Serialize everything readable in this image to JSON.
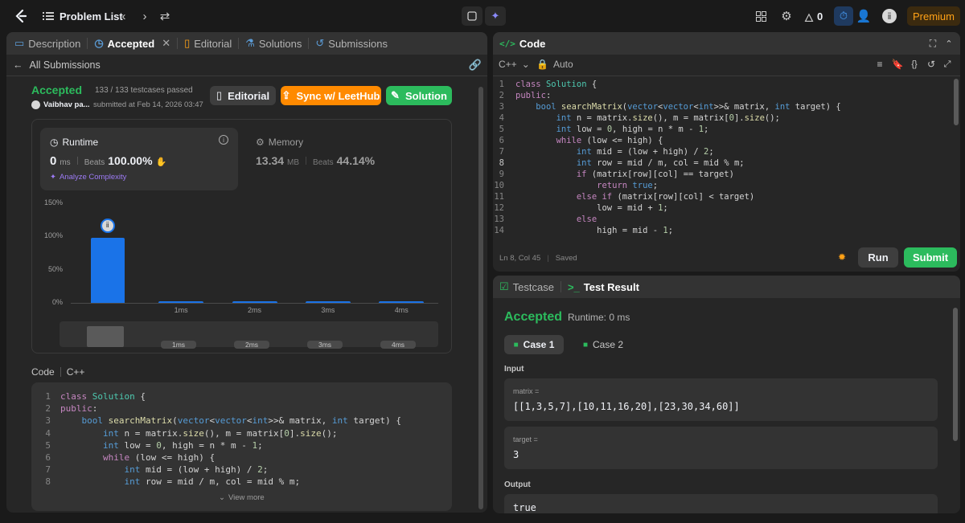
{
  "topbar": {
    "problem_list": "Problem List",
    "streak_count": "0",
    "premium": "Premium"
  },
  "left": {
    "tabs": [
      "Description",
      "Accepted",
      "Editorial",
      "Solutions",
      "Submissions"
    ],
    "back_label": "All Submissions",
    "status": "Accepted",
    "testcases": "133 / 133 testcases passed",
    "user": "Vaibhav pa...",
    "submitted": "submitted at Feb 14, 2026 03:47",
    "btn_editorial": "Editorial",
    "btn_sync": "Sync w/ LeetHub",
    "btn_solution": "Solution",
    "runtime_label": "Runtime",
    "runtime_value": "0",
    "runtime_unit": "ms",
    "beats_label": "Beats",
    "runtime_beats": "100.00%",
    "analyze": "Analyze Complexity",
    "memory_label": "Memory",
    "memory_value": "13.34",
    "memory_unit": "MB",
    "memory_beats": "44.14%",
    "code_label": "Code",
    "code_lang": "C++",
    "view_more": "View more"
  },
  "chart_data": {
    "type": "bar",
    "categories": [
      "",
      "1ms",
      "2ms",
      "3ms",
      "4ms"
    ],
    "values": [
      98,
      3,
      3,
      3,
      3
    ],
    "yticks": [
      "150%",
      "100%",
      "50%",
      "0%"
    ],
    "ylim": [
      0,
      150
    ],
    "mini_labels": [
      "1ms",
      "2ms",
      "3ms",
      "4ms"
    ]
  },
  "code_panel": {
    "title": "Code",
    "lang": "C++",
    "mode": "Auto",
    "status": "Ln 8, Col 45",
    "saved": "Saved",
    "run": "Run",
    "submit": "Submit"
  },
  "result_panel": {
    "tab_testcase": "Testcase",
    "tab_result": "Test Result",
    "status": "Accepted",
    "runtime": "Runtime: 0 ms",
    "case1": "Case 1",
    "case2": "Case 2",
    "input_label": "Input",
    "matrix_label": "matrix =",
    "matrix_value": "[[1,3,5,7],[10,11,16,20],[23,30,34,60]]",
    "target_label": "target =",
    "target_value": "3",
    "output_label": "Output",
    "output_value": "true"
  },
  "code_lines": [
    "class Solution {",
    "public:",
    "    bool searchMatrix(vector<vector<int>>& matrix, int target) {",
    "        int n = matrix.size(), m = matrix[0].size();",
    "        int low = 0, high = n * m - 1;",
    "        while (low <= high) {",
    "            int mid = (low + high) / 2;",
    "            int row = mid / m, col = mid % m;",
    "            if (matrix[row][col] == target)",
    "                return true;",
    "            else if (matrix[row][col] < target)",
    "                low = mid + 1;",
    "            else",
    "                high = mid - 1;"
  ],
  "colors": {
    "accent_green": "#2cbb5d",
    "orange": "#ff8a00",
    "blue_bar": "#1a73e8",
    "premium": "#ffa116"
  }
}
